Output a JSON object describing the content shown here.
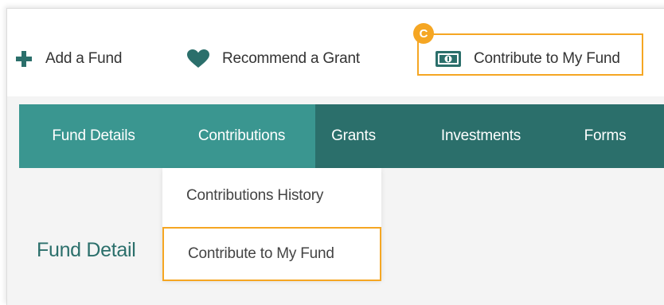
{
  "actions": {
    "add_fund": {
      "label": "Add a Fund",
      "icon": "plus-icon"
    },
    "recommend_grant": {
      "label": "Recommend a Grant",
      "icon": "heart-icon"
    },
    "contribute": {
      "label": "Contribute to My Fund",
      "icon": "cash-icon"
    }
  },
  "callout_badge": "C",
  "nav": {
    "tabs": [
      {
        "label": "Fund Details",
        "active": true
      },
      {
        "label": "Contributions",
        "active": true
      },
      {
        "label": "Grants",
        "active": false
      },
      {
        "label": "Investments",
        "active": false
      },
      {
        "label": "Forms",
        "active": false
      }
    ]
  },
  "dropdown": {
    "items": [
      {
        "label": "Contributions History",
        "highlighted": false
      },
      {
        "label": "Contribute to My Fund",
        "highlighted": true
      }
    ]
  },
  "page": {
    "heading": "Fund Detail"
  },
  "colors": {
    "teal_dark": "#2b6f6b",
    "teal_light": "#3a9690",
    "highlight": "#f5a623",
    "text": "#333333"
  }
}
